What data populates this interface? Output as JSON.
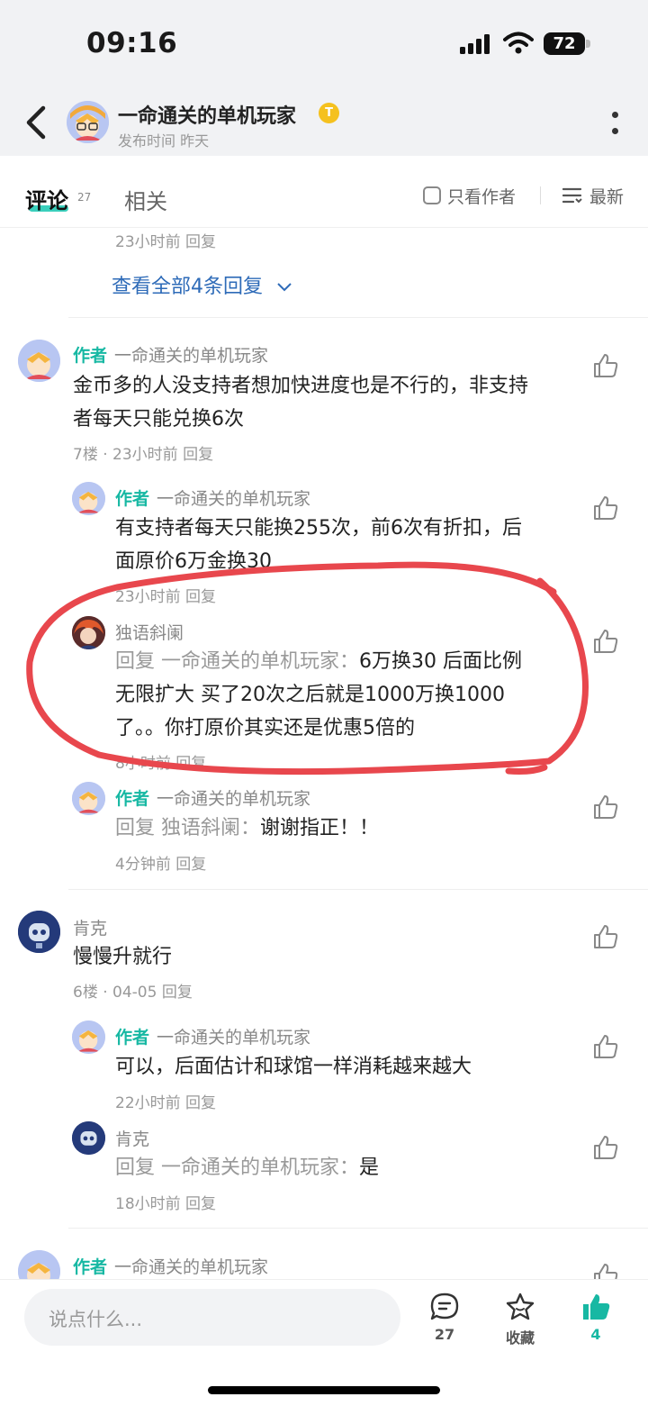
{
  "status_bar": {
    "time": "09:16",
    "battery": "72"
  },
  "header": {
    "user_name": "一命通关的单机玩家",
    "badge": "T",
    "sub": "发布时间  昨天"
  },
  "tabs": {
    "comments_label": "评论",
    "comments_count": "27",
    "related_label": "相关",
    "only_author_label": "只看作者",
    "sort_label": "最新"
  },
  "thread_top": {
    "meta": "23小时前  回复",
    "view_all": "查看全部4条回复"
  },
  "comments": {
    "c7": {
      "author_tag": "作者",
      "name": "一命通关的单机玩家",
      "lines": [
        "金币多的人没支持者想加快进度也是不行的，非支持",
        "者每天只能兑换6次"
      ],
      "meta": "7楼 · 23小时前  回复",
      "replies": [
        {
          "author_tag": "作者",
          "name": "一命通关的单机玩家",
          "lines": [
            "有支持者每天只能换255次，前6次有折扣，后",
            "面原价6万金换30"
          ],
          "meta": "23小时前  回复"
        },
        {
          "name": "独语斜阑",
          "reply_prefix": "回复 一命通关的单机玩家：",
          "lines": [
            "6万换30 后面比例",
            "无限扩大 买了20次之后就是1000万换1000",
            "了。。你打原价其实还是优惠5倍的"
          ],
          "meta": "8小时前  回复"
        },
        {
          "author_tag": "作者",
          "name": "一命通关的单机玩家",
          "reply_prefix": "回复 独语斜阑：",
          "lines": [
            "谢谢指正！！"
          ],
          "meta": "4分钟前  回复"
        }
      ]
    },
    "c6": {
      "name": "肯克",
      "lines": [
        "慢慢升就行"
      ],
      "meta": "6楼 · 04-05  回复",
      "replies": [
        {
          "author_tag": "作者",
          "name": "一命通关的单机玩家",
          "lines": [
            "可以，后面估计和球馆一样消耗越来越大"
          ],
          "meta": "22小时前  回复"
        },
        {
          "name": "肯克",
          "reply_prefix": "回复 一命通关的单机玩家：",
          "lines": [
            "是"
          ],
          "meta": "18小时前  回复"
        }
      ]
    },
    "c5": {
      "author_tag": "作者",
      "name": "一命通关的单机玩家"
    }
  },
  "bottom_bar": {
    "placeholder": "说点什么...",
    "comment_count": "27",
    "favorite_label": "收藏",
    "like_count": "4"
  },
  "colors": {
    "accent": "#17b8a3",
    "link": "#2e6bb8",
    "annotation": "#e8474d"
  }
}
